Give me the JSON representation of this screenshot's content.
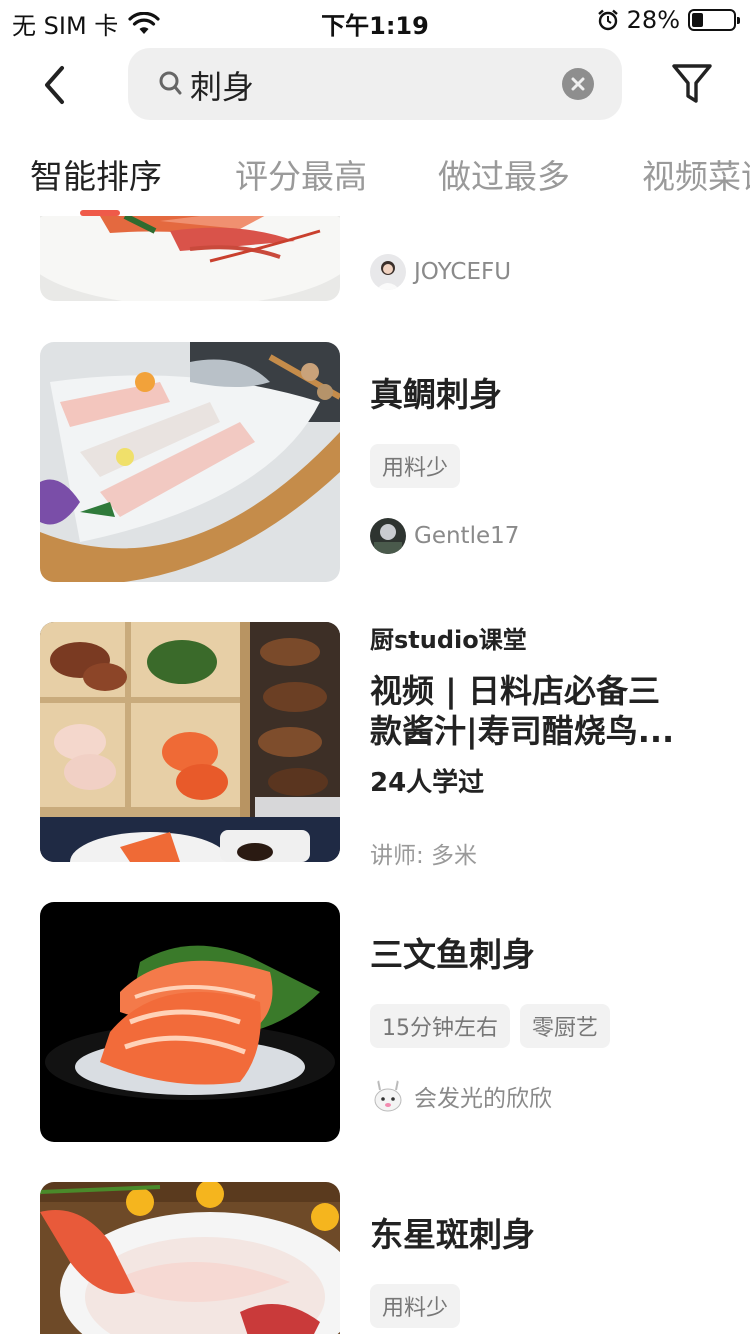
{
  "status_bar": {
    "carrier": "无 SIM 卡",
    "time": "下午1:19",
    "battery_percent": "28%",
    "battery_level": 0.28
  },
  "search": {
    "query": "刺身"
  },
  "tabs": [
    {
      "label": "智能排序",
      "active": true
    },
    {
      "label": "评分最高",
      "active": false
    },
    {
      "label": "做过最多",
      "active": false
    },
    {
      "label": "视频菜谱",
      "active": false
    }
  ],
  "items": [
    {
      "author": "JOYCEFU"
    },
    {
      "title": "真鲷刺身",
      "tags": [
        "用料少"
      ],
      "author": "Gentle17"
    },
    {
      "studio": "厨studio课堂",
      "title_line1": "视频 | 日料店必备三",
      "title_line2": "款酱汁|寿司醋烧鸟...",
      "learners": "24人学过",
      "teacher": "讲师: 多米"
    },
    {
      "title": "三文鱼刺身",
      "tags": [
        "15分钟左右",
        "零厨艺"
      ],
      "author": "会发光的欣欣"
    },
    {
      "title": "东星斑刺身",
      "tags": [
        "用料少"
      ]
    }
  ],
  "colors": {
    "accent": "#ef5a49",
    "tag_bg": "#f2f2f2",
    "search_bg": "#efefef"
  }
}
